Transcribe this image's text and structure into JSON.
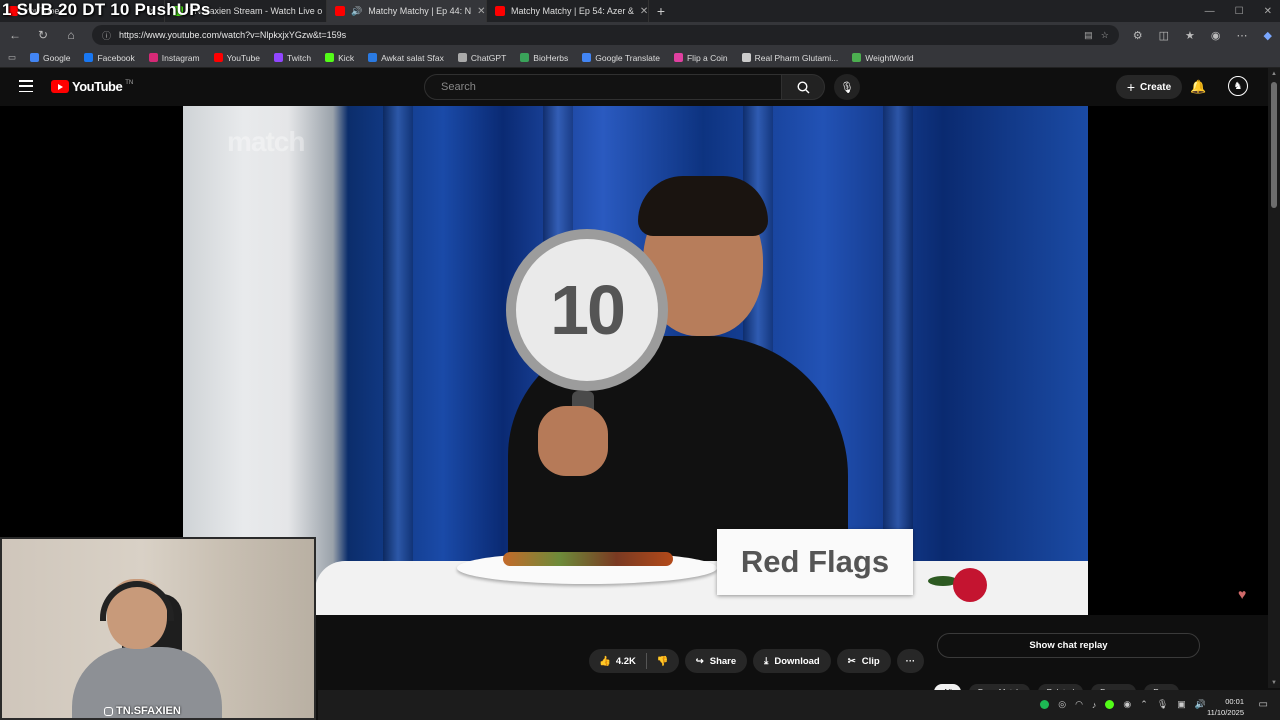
{
  "overlay": {
    "text": "1 SUB 20 DT 10 PushUPs"
  },
  "browser": {
    "tabs": [
      {
        "label": "YouTube",
        "color": "#ff0000"
      },
      {
        "label": "TNSfaxien Stream - Watch Live o",
        "color": "#53fc18"
      },
      {
        "label": "Matchy Matchy | Ep 44: N",
        "color": "#ff0000"
      },
      {
        "label": "Matchy Matchy | Ep 54: Azer &",
        "color": "#ff0000"
      }
    ],
    "new_tab": "+",
    "url": "https://www.youtube.com/watch?v=NlpkxjxYGzw&t=159s",
    "window_controls": [
      "—",
      "☐",
      "✕"
    ]
  },
  "bookmarks": [
    {
      "label": "Google",
      "color": "#4285f4"
    },
    {
      "label": "Facebook",
      "color": "#1877f2"
    },
    {
      "label": "Instagram",
      "color": "#d62976"
    },
    {
      "label": "YouTube",
      "color": "#ff0000"
    },
    {
      "label": "Twitch",
      "color": "#9146ff"
    },
    {
      "label": "Kick",
      "color": "#53fc18"
    },
    {
      "label": "Awkat salat Sfax",
      "color": "#2a7ae2"
    },
    {
      "label": "ChatGPT",
      "color": "#aaaaaa"
    },
    {
      "label": "BioHerbs",
      "color": "#3aa35a"
    },
    {
      "label": "Google Translate",
      "color": "#4285f4"
    },
    {
      "label": "Flip a Coin",
      "color": "#e040a0"
    },
    {
      "label": "Real Pharm Glutami...",
      "color": "#cccccc"
    },
    {
      "label": "WeightWorld",
      "color": "#4caf50"
    }
  ],
  "youtube": {
    "logo_text": "YouTube",
    "logo_country": "TN",
    "search_placeholder": "Search",
    "create_label": "Create"
  },
  "video": {
    "watermark": "match",
    "sign_number": "10",
    "placard_text": "Red Flags"
  },
  "below_video": {
    "likes": "4.2K",
    "share_label": "Share",
    "download_label": "Download",
    "clip_label": "Clip",
    "more_label": "···",
    "chat_replay_label": "Show chat replay",
    "chips": [
      "All",
      "From Match",
      "Related",
      "For you",
      "Re..."
    ]
  },
  "webcam": {
    "handle": "TN.SFAXIEN"
  },
  "taskbar": {
    "time": "00:01",
    "date": "11/10/2025"
  }
}
